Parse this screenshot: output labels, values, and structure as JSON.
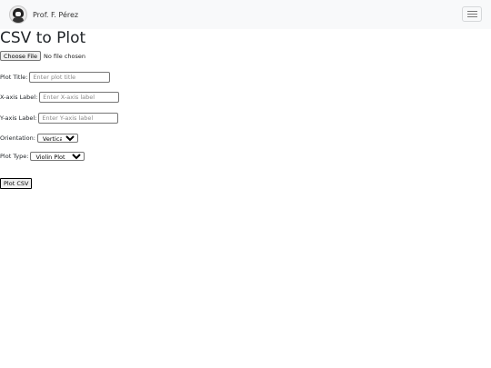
{
  "navbar": {
    "brand_name": "Prof. F. Pérez",
    "menu_icon": "hamburger-icon"
  },
  "page": {
    "title": "CSV to Plot"
  },
  "file_input": {
    "button_label": "Choose File",
    "status": "No file chosen"
  },
  "form": {
    "plot_title": {
      "label": "Plot Title:",
      "placeholder": "Enter plot title",
      "value": ""
    },
    "x_label": {
      "label": "X-axis Label:",
      "placeholder": "Enter X-axis label",
      "value": ""
    },
    "y_label": {
      "label": "Y-axis Label:",
      "placeholder": "Enter Y-axis label",
      "value": ""
    },
    "orientation": {
      "label": "Orientation:",
      "selected": "Vertical"
    },
    "plot_type": {
      "label": "Plot Type:",
      "selected": "Violin Plot"
    }
  },
  "submit": {
    "label": "Plot CSV"
  }
}
